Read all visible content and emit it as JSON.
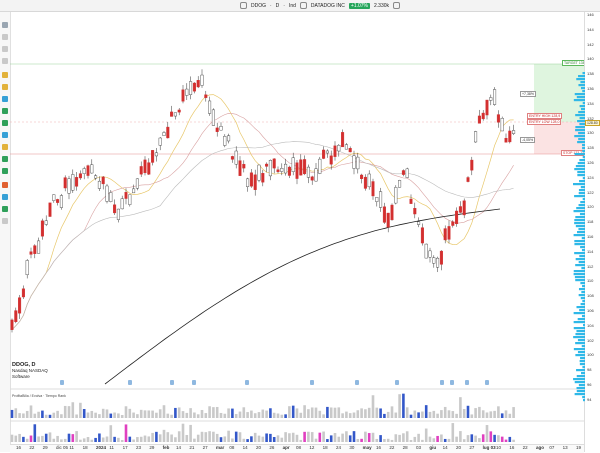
{
  "header": {
    "symbol": "DDOG",
    "interval": "D",
    "indicators_label": "Ind",
    "company": "DATADOG INC",
    "change_pct": "+1.07%",
    "volume": "2.330k"
  },
  "legend": {
    "symbol": "DDOG, D",
    "exchange": "Nasdaq NASDAQ",
    "sector": "Software"
  },
  "panes": {
    "profile_label": "ProfitaBilia / Evolva · Tiempo Rank"
  },
  "price_axis": {
    "ticks": [
      "146",
      "144",
      "142",
      "140",
      "138",
      "136",
      "134",
      "132",
      "130",
      "128",
      "126",
      "124",
      "122",
      "120",
      "118",
      "116",
      "114",
      "112",
      "110",
      "108",
      "106",
      "104",
      "102",
      "100",
      "98",
      "96",
      "94"
    ]
  },
  "levels": {
    "target": "TARGET 138,59",
    "pct_up": "+7,38%",
    "entry_high": "ENTRY HIGH 128,9",
    "entry_low": "ENTRY LOW 128,0",
    "pct_down": "-4,05%",
    "stop": "STOP 122,71",
    "last_price": "128.80"
  },
  "dates": [
    {
      "label": "16",
      "bold": false
    },
    {
      "label": "22",
      "bold": false
    },
    {
      "label": "29",
      "bold": false
    },
    {
      "label": "dic 05",
      "bold": false
    },
    {
      "label": "11",
      "bold": false
    },
    {
      "label": "18",
      "bold": false
    },
    {
      "label": "2024",
      "bold": true
    },
    {
      "label": "11",
      "bold": false
    },
    {
      "label": "17",
      "bold": false
    },
    {
      "label": "23",
      "bold": false
    },
    {
      "label": "29",
      "bold": false
    },
    {
      "label": "feb",
      "bold": true
    },
    {
      "label": "14",
      "bold": false
    },
    {
      "label": "21",
      "bold": false
    },
    {
      "label": "27",
      "bold": false
    },
    {
      "label": "mar",
      "bold": true
    },
    {
      "label": "08",
      "bold": false
    },
    {
      "label": "14",
      "bold": false
    },
    {
      "label": "20",
      "bold": false
    },
    {
      "label": "26",
      "bold": false
    },
    {
      "label": "apr",
      "bold": true
    },
    {
      "label": "08",
      "bold": false
    },
    {
      "label": "12",
      "bold": false
    },
    {
      "label": "18",
      "bold": false
    },
    {
      "label": "24",
      "bold": false
    },
    {
      "label": "30",
      "bold": false
    },
    {
      "label": "may",
      "bold": true
    },
    {
      "label": "16",
      "bold": false
    },
    {
      "label": "22",
      "bold": false
    },
    {
      "label": "28",
      "bold": false
    },
    {
      "label": "03",
      "bold": false
    },
    {
      "label": "giu",
      "bold": true
    },
    {
      "label": "14",
      "bold": false
    },
    {
      "label": "20",
      "bold": false
    },
    {
      "label": "27",
      "bold": false
    },
    {
      "label": "lug 03",
      "bold": true
    },
    {
      "label": "10",
      "bold": false
    },
    {
      "label": "16",
      "bold": false
    },
    {
      "label": "22",
      "bold": false
    },
    {
      "label": "ago",
      "bold": true
    },
    {
      "label": "07",
      "bold": false
    },
    {
      "label": "13",
      "bold": false
    },
    {
      "label": "19",
      "bold": false
    }
  ],
  "colors": {
    "up_candle": "#ffffff",
    "down_candle": "#d32f2f",
    "ma_long": "#222222",
    "ma_fast": "#e8c76a",
    "ma_mid": "#d9a2a2",
    "volume_blue": "#3357c9",
    "volume_magenta": "#e040c0",
    "target_zone": "#dff5df",
    "stop_zone": "#fbe3e3",
    "profile": "#2fb8e8"
  }
}
